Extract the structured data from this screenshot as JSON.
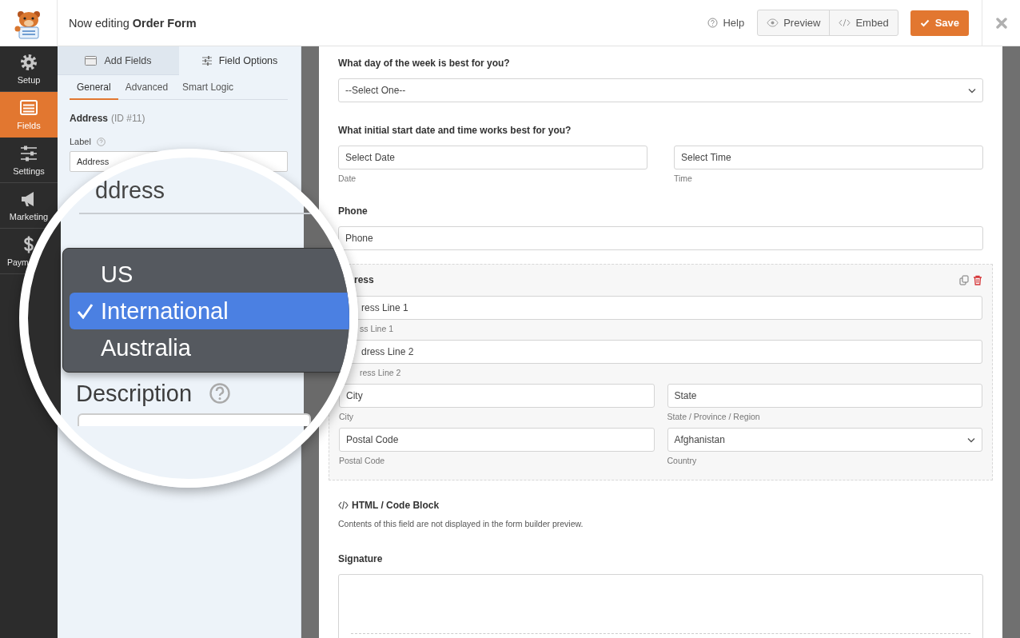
{
  "header": {
    "title": "Now editing **Order Form**",
    "help": "Help",
    "buttons": [
      {
        "label": "Preview",
        "kind": "preview"
      },
      {
        "label": "Embed",
        "kind": "embed"
      }
    ],
    "save": "Save"
  },
  "sidebar": {
    "items": [
      {
        "label": "Setup",
        "kind": "setup",
        "selected": false
      },
      {
        "label": "Fields",
        "kind": "fields",
        "selected": true
      },
      {
        "label": "Settings",
        "kind": "settings",
        "selected": false
      },
      {
        "label": "Marketing",
        "kind": "marketing",
        "selected": false
      },
      {
        "label": "Paym",
        "kind": "payments",
        "selected": false
      }
    ]
  },
  "panel": {
    "tabs": [
      {
        "label": "Add Fields",
        "kind": "add",
        "selected": false
      },
      {
        "label": "Field Options",
        "kind": "options",
        "selected": true
      }
    ],
    "subtabs": [
      {
        "label": "General",
        "selected": true
      },
      {
        "label": "Advanced",
        "selected": false
      },
      {
        "label": "Smart Logic",
        "selected": false
      }
    ],
    "field_name": "Address",
    "field_id": "(ID #11)",
    "label_caption": "Label",
    "label_value": "Address"
  },
  "magnifier": {
    "heading": "ddress",
    "menu": [
      {
        "label": "US",
        "selected": false
      },
      {
        "label": "International",
        "selected": true
      },
      {
        "label": "Australia",
        "selected": false
      }
    ],
    "description_label": "Description"
  },
  "form": {
    "fields": [
      {
        "kind": "select",
        "label": "What day of the week is best for you?",
        "value": "--Select One--"
      },
      {
        "kind": "pair",
        "label": "What initial start date and time works best for you?",
        "inputs": [
          {
            "placeholder": "Select Date",
            "sublabel": "Date"
          },
          {
            "placeholder": "Select Time",
            "sublabel": "Time"
          }
        ]
      },
      {
        "kind": "input",
        "label": "Phone",
        "placeholder": "Phone"
      },
      {
        "kind": "address",
        "label": "ress",
        "rows": [
          [
            {
              "kind": "input",
              "placeholder": "ress Line 1",
              "sublabel": "ss Line 1"
            }
          ],
          [
            {
              "kind": "input",
              "placeholder": "dress Line 2",
              "sublabel": "ress Line 2"
            }
          ],
          [
            {
              "kind": "input",
              "placeholder": "City",
              "sublabel": "City"
            },
            {
              "kind": "input",
              "placeholder": "State",
              "sublabel": "State / Province / Region"
            }
          ],
          [
            {
              "kind": "input",
              "placeholder": "Postal Code",
              "sublabel": "Postal Code"
            },
            {
              "kind": "select",
              "value": "Afghanistan",
              "sublabel": "Country"
            }
          ]
        ]
      },
      {
        "kind": "html",
        "label": "HTML / Code Block",
        "description": "Contents of this field are not displayed in the form builder preview."
      },
      {
        "kind": "signature",
        "label": "Signature"
      }
    ]
  }
}
